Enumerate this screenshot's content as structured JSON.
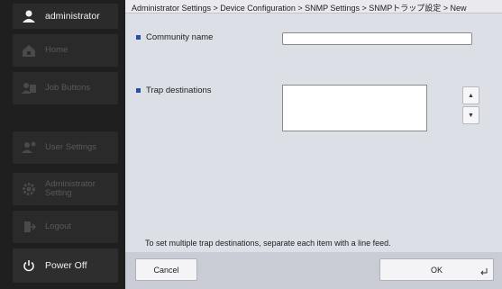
{
  "sidebar": {
    "user": {
      "label": "administrator",
      "icon": "user-icon"
    },
    "items": [
      {
        "label": "Home",
        "icon": "home-icon"
      },
      {
        "label": "Job Buttons",
        "icon": "job-buttons-icon"
      },
      {
        "label": "User Settings",
        "icon": "user-settings-icon"
      },
      {
        "label": "Administrator Setting",
        "icon": "admin-gear-icon"
      },
      {
        "label": "Logout",
        "icon": "logout-icon"
      }
    ],
    "power": {
      "label": "Power Off",
      "icon": "power-icon"
    }
  },
  "header": {
    "breadcrumb": "Administrator Settings > Device Configuration > SNMP Settings > SNMPトラップ設定 > New"
  },
  "form": {
    "community_label": "Community name",
    "community_value": "",
    "trap_label": "Trap destinations",
    "trap_value": "",
    "hint": "To set multiple trap destinations, separate each item with a line feed."
  },
  "footer": {
    "cancel_label": "Cancel",
    "ok_label": "OK"
  },
  "colors": {
    "sidebar_bg": "#1f1f1f",
    "main_bg": "#dcdfe6",
    "bullet": "#2b4fa8"
  }
}
